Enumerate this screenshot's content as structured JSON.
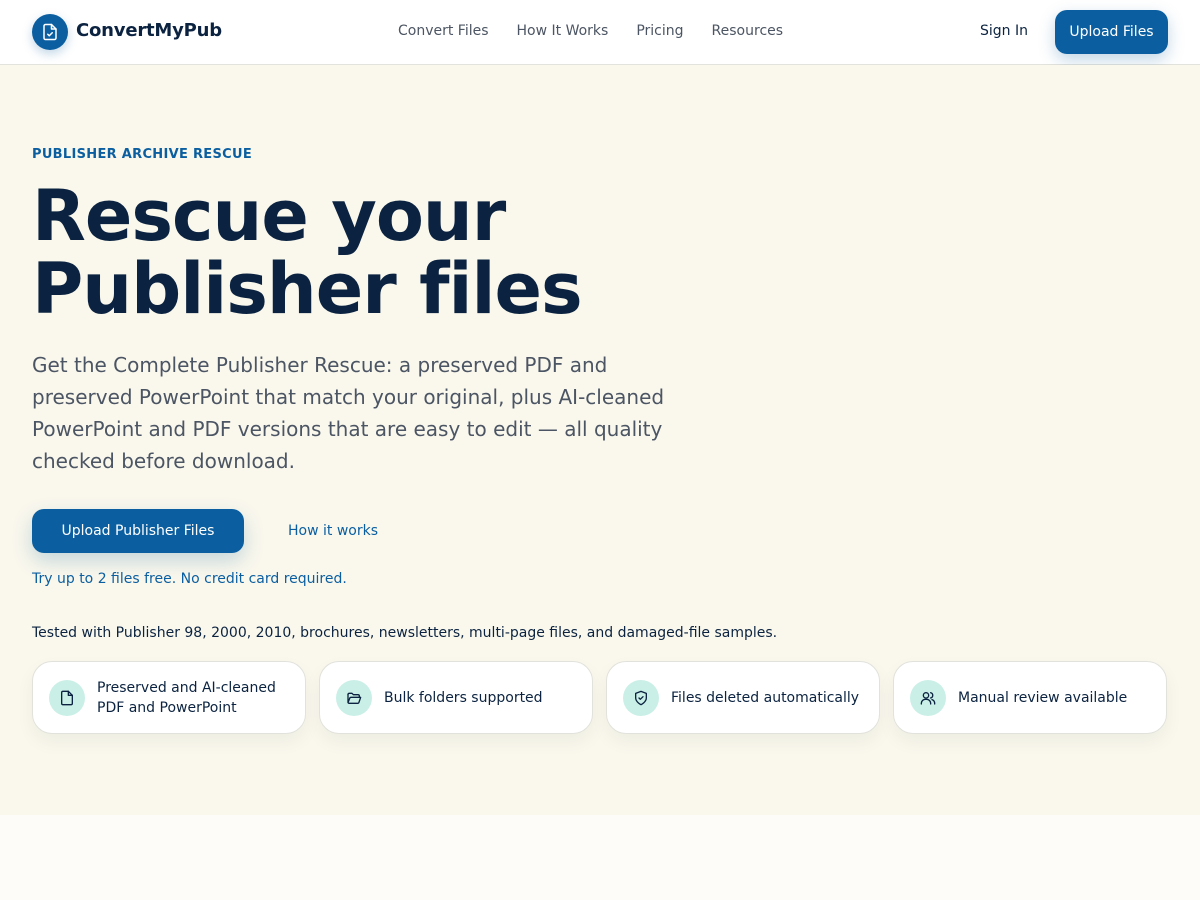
{
  "brand": {
    "name": "ConvertMyPub",
    "icon": "file-refresh-icon",
    "color": "#0b5fa0"
  },
  "nav": {
    "items": [
      {
        "label": "Convert Files"
      },
      {
        "label": "How It Works"
      },
      {
        "label": "Pricing"
      },
      {
        "label": "Resources"
      }
    ],
    "sign_in": "Sign In",
    "upload": "Upload Files"
  },
  "hero": {
    "eyebrow": "PUBLISHER ARCHIVE RESCUE",
    "headline": "Rescue your Publisher files",
    "subtext": "Get the Complete Publisher Rescue: a preserved PDF and preserved PowerPoint that match your original, plus AI-cleaned PowerPoint and PDF versions that are easy to edit — all quality checked before download.",
    "cta_primary": "Upload Publisher Files",
    "cta_secondary": "How it works",
    "free_note": "Try up to 2 files free. No credit card required.",
    "tested": "Tested with Publisher 98, 2000, 2010, brochures, newsletters, multi-page files, and damaged-file samples."
  },
  "features": [
    {
      "label": "Preserved and AI-cleaned PDF and PowerPoint",
      "icon": "file-icon"
    },
    {
      "label": "Bulk folders supported",
      "icon": "folder-open-icon"
    },
    {
      "label": "Files deleted automatically",
      "icon": "shield-check-icon"
    },
    {
      "label": "Manual review available",
      "icon": "users-icon"
    }
  ],
  "colors": {
    "accent": "#0b5fa0",
    "heading": "#0b2340",
    "feature_icon_bg": "#c9efe6"
  }
}
